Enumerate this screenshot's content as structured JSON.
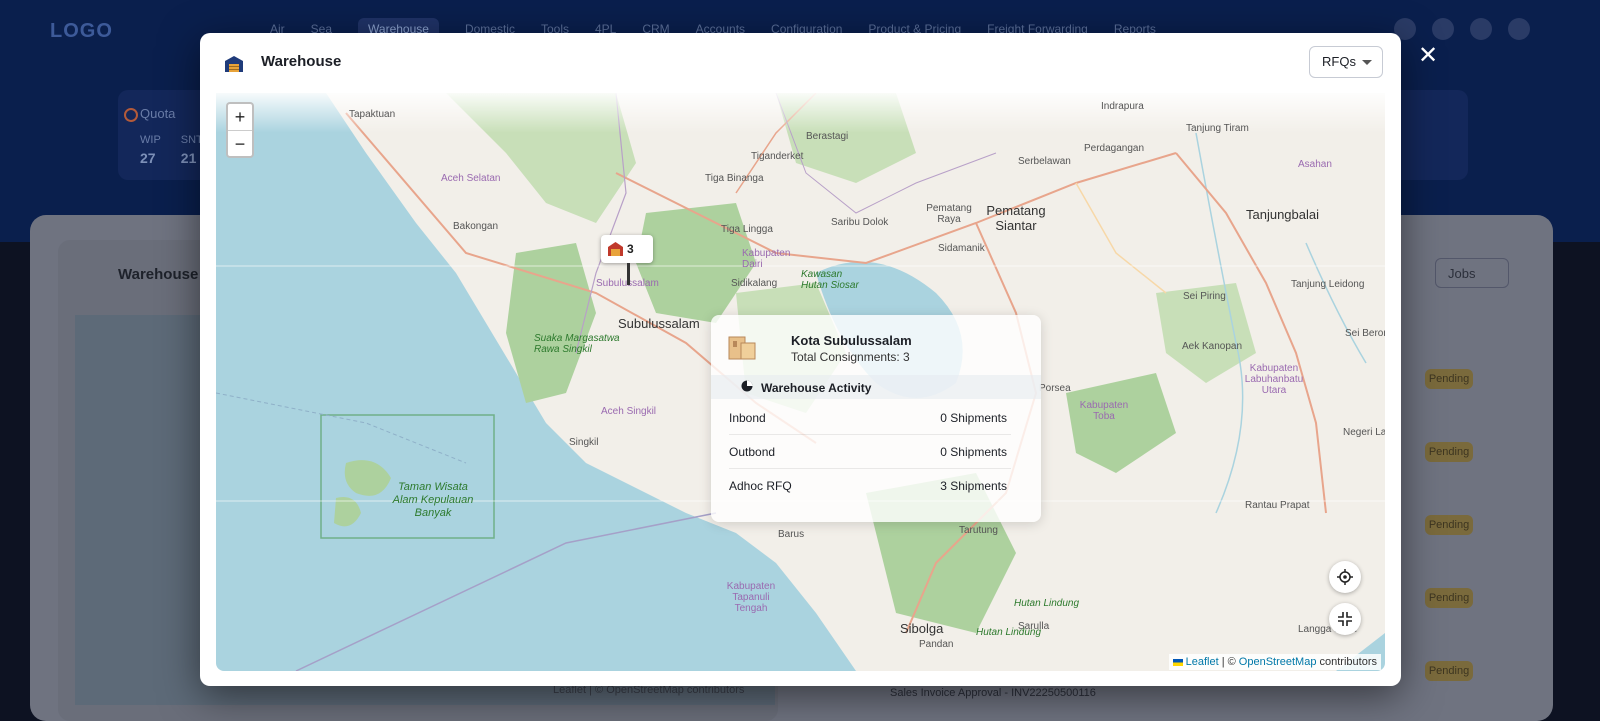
{
  "background": {
    "logo": "LOGO",
    "nav": [
      "Air",
      "Sea",
      "Warehouse",
      "Domestic",
      "Tools",
      "4PL",
      "CRM",
      "Accounts",
      "Configuration",
      "Product & Pricing",
      "Freight Forwarding",
      "Reports"
    ],
    "quota": {
      "title": "Quota",
      "stats": [
        {
          "label": "WIP",
          "value": "27"
        },
        {
          "label": "SNT",
          "value": "21"
        }
      ]
    },
    "warehouse_title": "Warehouse",
    "jobs_label": "Jobs",
    "pending_label": "Pending",
    "sales_line": "Sales Invoice Approval - INV22250500116",
    "attribution": {
      "leaflet": "Leaflet",
      "sep": "| ©",
      "osm": "OpenStreetMap",
      "tail": "contributors"
    }
  },
  "modal": {
    "title": "Warehouse",
    "select_value": "RFQs",
    "close_label": "✕"
  },
  "map": {
    "zoom_in": "+",
    "zoom_out": "−",
    "marker_count": "3",
    "attribution": {
      "leaflet": "Leaflet",
      "sep": "| ©",
      "osm": "OpenStreetMap",
      "tail": "contributors"
    },
    "labels": {
      "tapaktuan": "Tapaktuan",
      "aceh_selatan": "Aceh Selatan",
      "bakongan": "Bakongan",
      "subulussalam_small": "Subulussalam",
      "subulussalam": "Subulussalam",
      "suaka": "Suaka Margasatwa Rawa Singkil",
      "aceh_singkil": "Aceh Singkil",
      "singkil": "Singkil",
      "taman": "Taman Wisata Alam Kepulauan Banyak",
      "berastagi": "Berastagi",
      "tiganderket": "Tiganderket",
      "tiga_binanga": "Tiga Binanga",
      "tiga_lingga": "Tiga Lingga",
      "kabupaten_dairi": "Kabupaten Dairi",
      "sidikalang": "Sidikalang",
      "kawasan": "Kawasan Hutan Siosar",
      "saribu_dolok": "Saribu Dolok",
      "pematang_raya": "Pematang Raya",
      "pematang_siantar": "Pematang Siantar",
      "sidamanik": "Sidamanik",
      "serbelawan": "Serbelawan",
      "perdagangan": "Perdagangan",
      "indrapura": "Indrapura",
      "tanjung_tiram": "Tanjung Tiram",
      "asahan": "Asahan",
      "tanjungbalai": "Tanjungbalai",
      "sei_piring": "Sei Piring",
      "tanjung_leidong": "Tanjung Leidong",
      "sei_berombang": "Sei Beron",
      "aek_kanopan": "Aek Kanopan",
      "kab_labuhan": "Kabupaten Labuhanbatu Utara",
      "kab_toba": "Kabupaten Toba",
      "porsea": "Porsea",
      "negeri_lama": "Negeri Lam",
      "rantau_prapat": "Rantau Prapat",
      "tarutung": "Tarutung",
      "barus": "Barus",
      "kab_tapanuli": "Kabupaten Tapanuli Tengah",
      "sibolga": "Sibolga",
      "pandan": "Pandan",
      "hutan_lindung1": "Hutan Lindung",
      "sarulla": "Sarulla",
      "hutan_lindung2": "Hutan Lindung",
      "langga_payung": "Langga Payu"
    }
  },
  "popup": {
    "title": "Kota Subulussalam",
    "subtitle": "Total Consignments: 3",
    "activity_label": "Warehouse Activity",
    "rows": [
      {
        "label": "Inbond",
        "value": "0 Shipments"
      },
      {
        "label": "Outbond",
        "value": "0 Shipments"
      },
      {
        "label": "Adhoc RFQ",
        "value": "3 Shipments"
      }
    ]
  },
  "colors": {
    "sea": "#aad3df",
    "land": "#f2efe9",
    "forest": "#add19e",
    "road": "#e8a58c",
    "header": "#0a1f4d"
  }
}
